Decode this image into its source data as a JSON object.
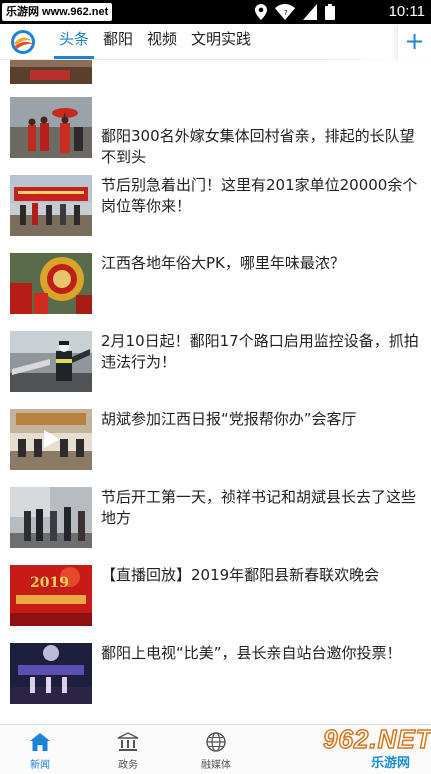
{
  "status_bar": {
    "watermark": "乐游网 www.962.net",
    "time": "10:11"
  },
  "channels": {
    "tabs": [
      {
        "label": "头条",
        "active": true
      },
      {
        "label": "鄱阳",
        "active": false
      },
      {
        "label": "视频",
        "active": false
      },
      {
        "label": "文明实践",
        "active": false
      }
    ],
    "add_label": "+"
  },
  "feed": {
    "items": [
      {
        "title": "",
        "image": "partial"
      },
      {
        "title": "鄱阳300名外嫁女集体回村省亲，排起的长队望不到头",
        "image": "umbrella-procession"
      },
      {
        "title": "节后别急着出门！这里有201家单位20000余个岗位等你来！",
        "image": "job-fair"
      },
      {
        "title": "江西各地年俗大PK，哪里年味最浓？",
        "image": "festival-drums"
      },
      {
        "title": "2月10日起！鄱阳17个路口启用监控设备，抓拍违法行为！",
        "image": "traffic-police"
      },
      {
        "title": "胡斌参加江西日报“党报帮你办”会客厅",
        "image": "video-studio",
        "video": true
      },
      {
        "title": "节后开工第一天，祯祥书记和胡斌县长去了这些地方",
        "image": "inspection"
      },
      {
        "title": "【直播回放】2019年鄱阳县新春联欢晚会",
        "image": "gala-banner"
      },
      {
        "title": "鄱阳上电视“比美”，县长亲自站台邀你投票！",
        "image": "tv-stage"
      }
    ]
  },
  "bottom_nav": {
    "items": [
      {
        "label": "新闻",
        "icon": "home-icon",
        "active": true
      },
      {
        "label": "政务",
        "icon": "bank-icon",
        "active": false
      },
      {
        "label": "融媒体",
        "icon": "globe-icon",
        "active": false
      }
    ],
    "watermark_big": "962.NET",
    "watermark_small": "乐游网"
  },
  "colors": {
    "accent": "#1d83d9",
    "status_bar": "#000000"
  }
}
